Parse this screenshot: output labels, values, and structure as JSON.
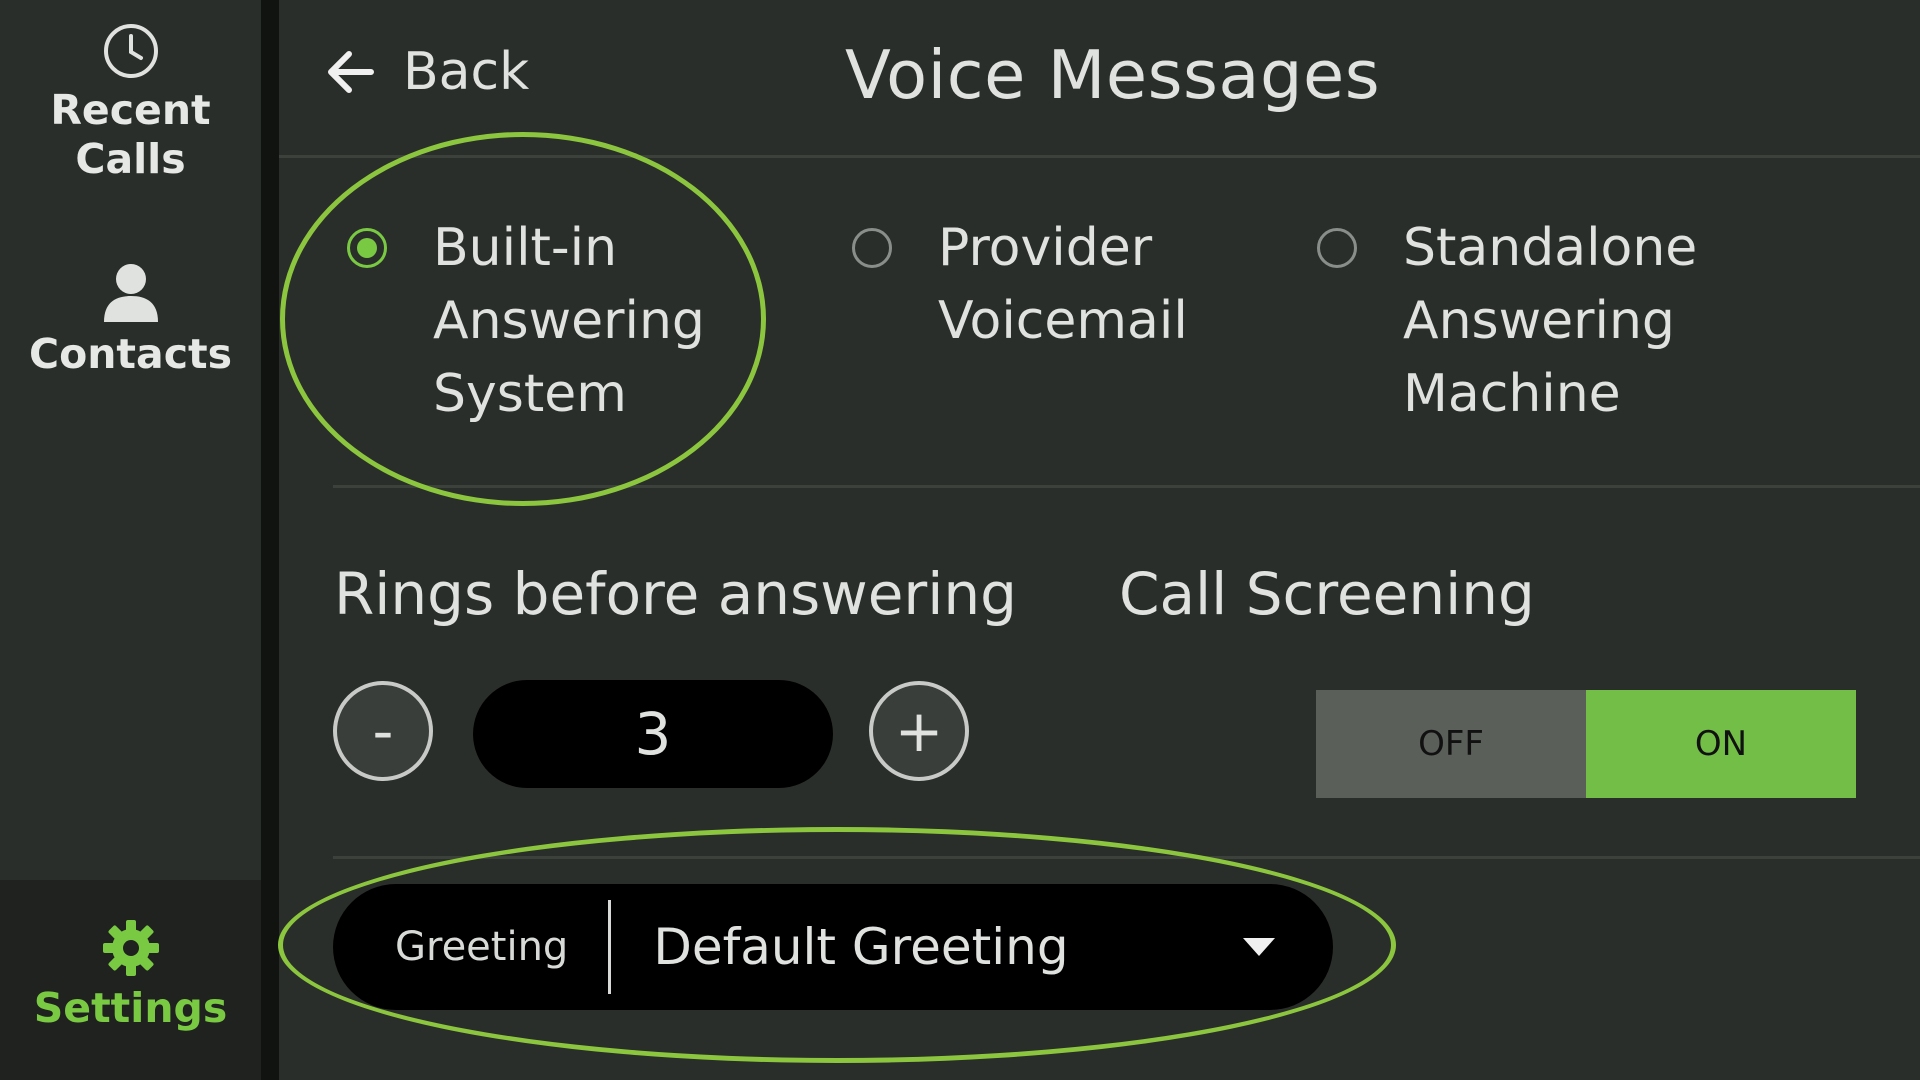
{
  "sidebar": {
    "items": [
      {
        "label": "Recent\nCalls",
        "icon": "clock-icon"
      },
      {
        "label": "Contacts",
        "icon": "person-icon"
      },
      {
        "label": "Settings",
        "icon": "gear-icon",
        "active": true
      }
    ]
  },
  "header": {
    "back_label": "Back",
    "title": "Voice Messages"
  },
  "mode_options": [
    {
      "label": "Built-in\nAnswering\nSystem",
      "selected": true
    },
    {
      "label": "Provider\nVoicemail",
      "selected": false
    },
    {
      "label": "Standalone\nAnswering\nMachine",
      "selected": false
    }
  ],
  "rings": {
    "label": "Rings before answering",
    "value": "3",
    "minus_label": "-",
    "plus_label": "+"
  },
  "call_screening": {
    "label": "Call Screening",
    "off_label": "OFF",
    "on_label": "ON",
    "state": "ON"
  },
  "greeting": {
    "label": "Greeting",
    "value": "Default Greeting"
  },
  "colors": {
    "accent": "#7ac943",
    "highlight": "#8cc63f",
    "background": "#2a2e2a"
  }
}
